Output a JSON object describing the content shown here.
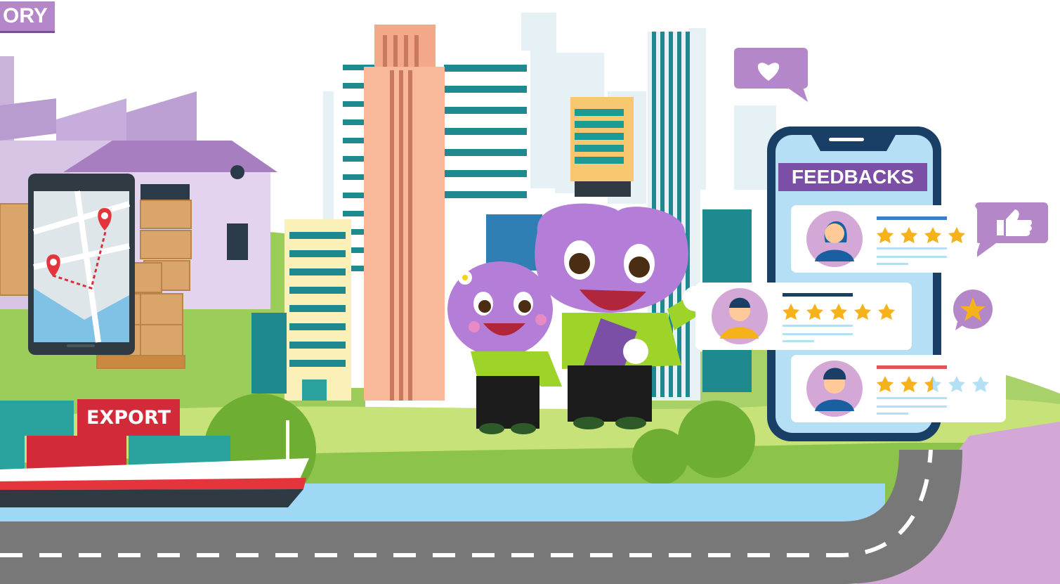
{
  "labels": {
    "factory": "ORY",
    "export": "EXPORT",
    "feedbacks": "FEEDBACKS"
  },
  "reviews": [
    {
      "avatar": "woman-avatar",
      "rating": 4
    },
    {
      "avatar": "man-avatar",
      "rating": 5
    },
    {
      "avatar": "man-avatar",
      "rating": 2.5
    }
  ],
  "icons": [
    "heart-icon",
    "thumbs-up-icon",
    "star-icon",
    "map-pin-icon"
  ],
  "colors": {
    "purple": "#b487c8",
    "dark_purple": "#7b4fa6",
    "grass": "#8cc34a",
    "road": "#777877",
    "water": "#9ed8f5",
    "phone_frame": "#1a3f66",
    "star": "#f5b21a",
    "teal": "#1e8a8f"
  }
}
